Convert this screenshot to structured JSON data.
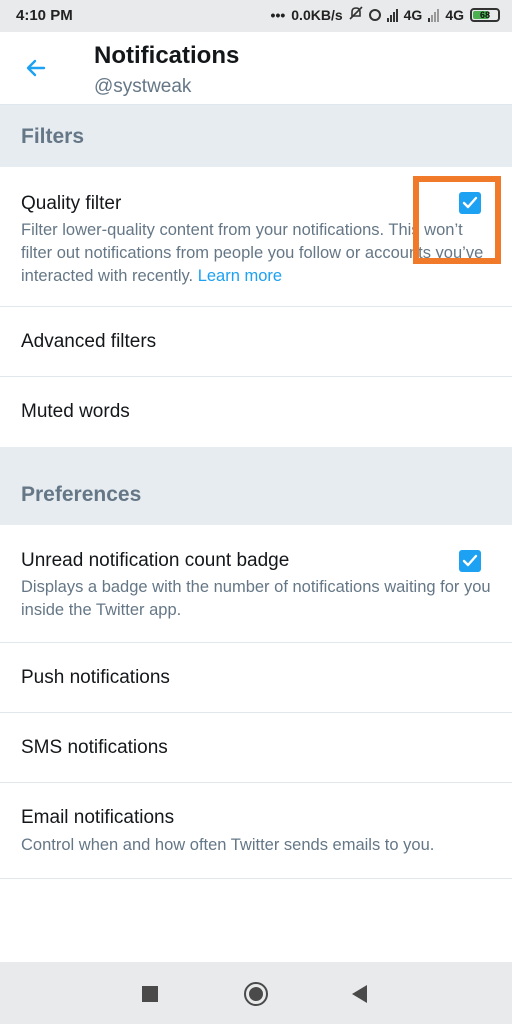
{
  "status_bar": {
    "time": "4:10 PM",
    "dots": "•••",
    "speed": "0.0KB/s",
    "network1": "4G",
    "network2": "4G",
    "battery": "68"
  },
  "header": {
    "title": "Notifications",
    "subtitle": "@systweak",
    "back_icon": "arrow-left-icon"
  },
  "filters": {
    "section_title": "Filters",
    "quality_filter": {
      "title": "Quality filter",
      "description": "Filter lower-quality content from your notifications. This won’t filter out notifications from people you follow or accounts you’ve interacted with recently.",
      "link": "Learn more",
      "checked": true
    },
    "advanced_filters": "Advanced filters",
    "muted_words": "Muted words"
  },
  "preferences": {
    "section_title": "Preferences",
    "unread_badge": {
      "title": "Unread notification count badge",
      "description": "Displays a badge with the number of notifications waiting for you inside the Twitter app.",
      "checked": true
    },
    "push": "Push notifications",
    "sms": "SMS notifications",
    "email": {
      "title": "Email notifications",
      "description": "Control when and how often Twitter sends emails to you."
    }
  },
  "colors": {
    "accent": "#1da1f2",
    "highlight": "#f07a2a",
    "section_bg": "#e6ecf0",
    "muted_text": "#657786"
  }
}
